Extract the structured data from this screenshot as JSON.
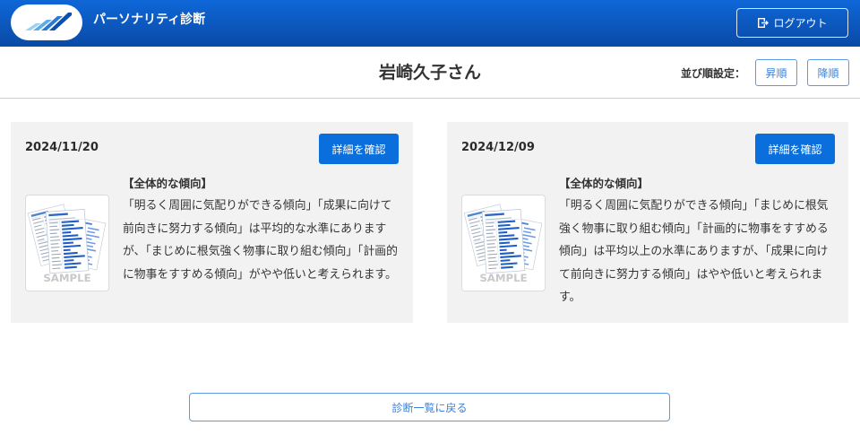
{
  "header": {
    "app_title": "パーソナリティ診断",
    "logo_icon": "stripes-logo-icon",
    "logout_icon": "logout-icon",
    "logout_label": "ログアウト"
  },
  "subheader": {
    "person_name": "岩崎久子さん",
    "sort_label": "並び順設定：",
    "sort_asc_label": "昇順",
    "sort_desc_label": "降順"
  },
  "results": [
    {
      "date": "2024/11/20",
      "detail_button_label": "詳細を確認",
      "section_heading": "【全体的な傾向】",
      "thumbnail_icon": "sample-report-thumbnail-icon",
      "thumbnail_watermark": "SAMPLE",
      "summary": "「明るく周囲に気配りができる傾向」「成果に向けて前向きに努力する傾向」は平均的な水準にありますが、「まじめに根気強く物事に取り組む傾向」「計画的に物事をすすめる傾向」がやや低いと考えられます。"
    },
    {
      "date": "2024/12/09",
      "detail_button_label": "詳細を確認",
      "section_heading": "【全体的な傾向】",
      "thumbnail_icon": "sample-report-thumbnail-icon",
      "thumbnail_watermark": "SAMPLE",
      "summary": "「明るく周囲に気配りができる傾向」「まじめに根気強く物事に取り組む傾向」「計画的に物事をすすめる傾向」は平均以上の水準にありますが、「成果に向けて前向きに努力する傾向」はやや低いと考えられます。"
    }
  ],
  "footer": {
    "back_button_label": "診断一覧に戻る"
  },
  "colors": {
    "primary": "#0a6fdc",
    "accent": "#3b82dc",
    "card_background": "#f2f2f2",
    "header_top": "#0e67d8",
    "header_bottom": "#0a4aa6",
    "text": "#333333"
  }
}
